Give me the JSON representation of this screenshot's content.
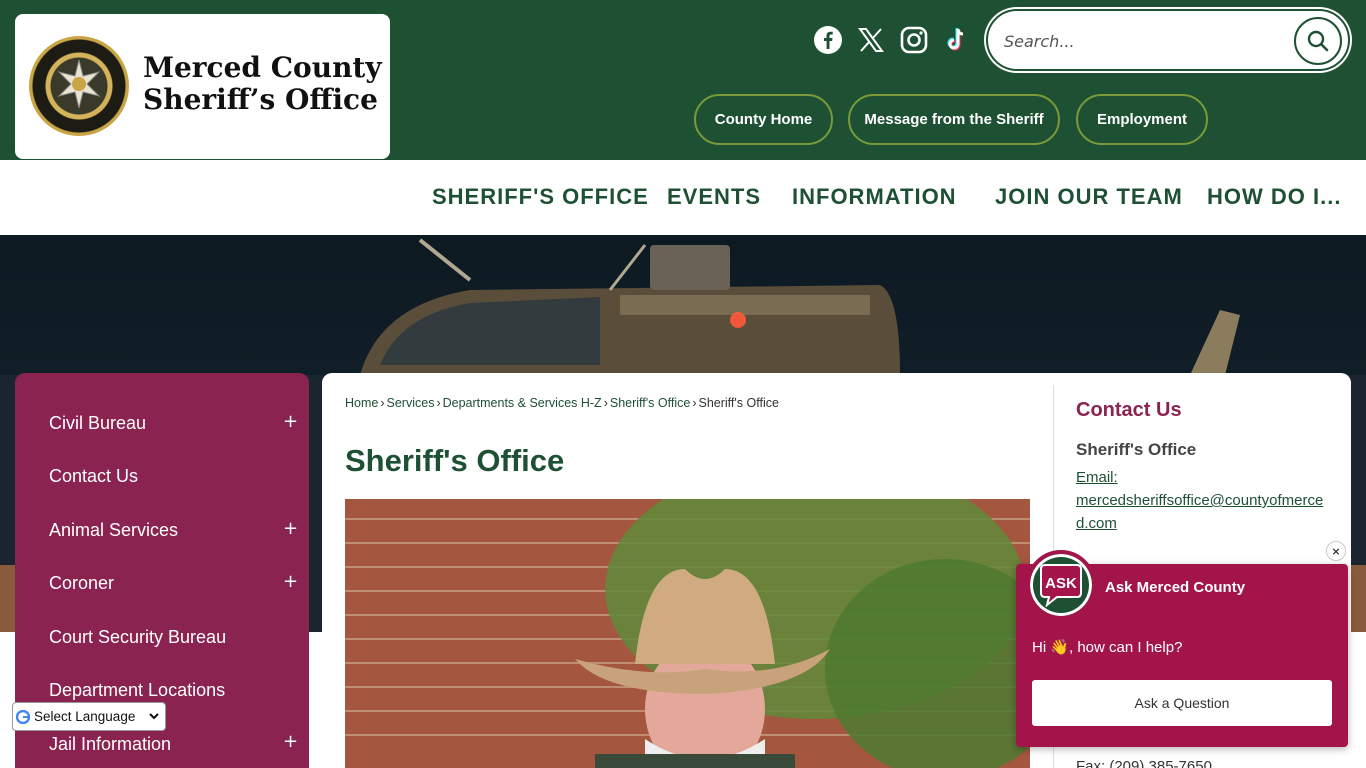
{
  "logo": {
    "line1": "Merced County",
    "line2": "Sheriff’s Office"
  },
  "social": [
    "facebook-icon",
    "x-icon",
    "instagram-icon",
    "tiktok-icon"
  ],
  "search": {
    "placeholder": "Search..."
  },
  "top_links": [
    "County Home",
    "Message from the Sheriff",
    "Employment"
  ],
  "nav": [
    "SHERIFF'S OFFICE",
    "EVENTS",
    "INFORMATION",
    "JOIN OUR TEAM",
    "HOW DO I..."
  ],
  "sidebar": {
    "items": [
      {
        "label": "Civil Bureau",
        "expand": "+"
      },
      {
        "label": "Contact Us",
        "expand": ""
      },
      {
        "label": "Animal Services",
        "expand": "+"
      },
      {
        "label": "Coroner",
        "expand": "+"
      },
      {
        "label": "Court Security Bureau",
        "expand": ""
      },
      {
        "label": "Department Locations",
        "expand": ""
      },
      {
        "label": "Jail Information",
        "expand": "+"
      }
    ]
  },
  "breadcrumb": [
    "Home",
    "Services",
    "Departments & Services H-Z",
    "Sheriff's Office",
    "Sheriff's Office"
  ],
  "page_title": "Sheriff's Office",
  "contact": {
    "heading": "Contact Us",
    "name": "Sheriff's Office",
    "email_label": "Email:",
    "email": "mercedsheriffsoffice@countyofmerced.com",
    "fax": "Fax: (209) 385-7650"
  },
  "translate": {
    "label": "Select Language"
  },
  "chat": {
    "logo_text": "ASK",
    "title": "Ask Merced County",
    "greeting": "Hi 👋, how can I help?",
    "button": "Ask a Question",
    "close": "×"
  },
  "colors": {
    "primary_green": "#1e5134",
    "sidebar_maroon": "#8b2350",
    "chat_maroon": "#a3154a"
  }
}
